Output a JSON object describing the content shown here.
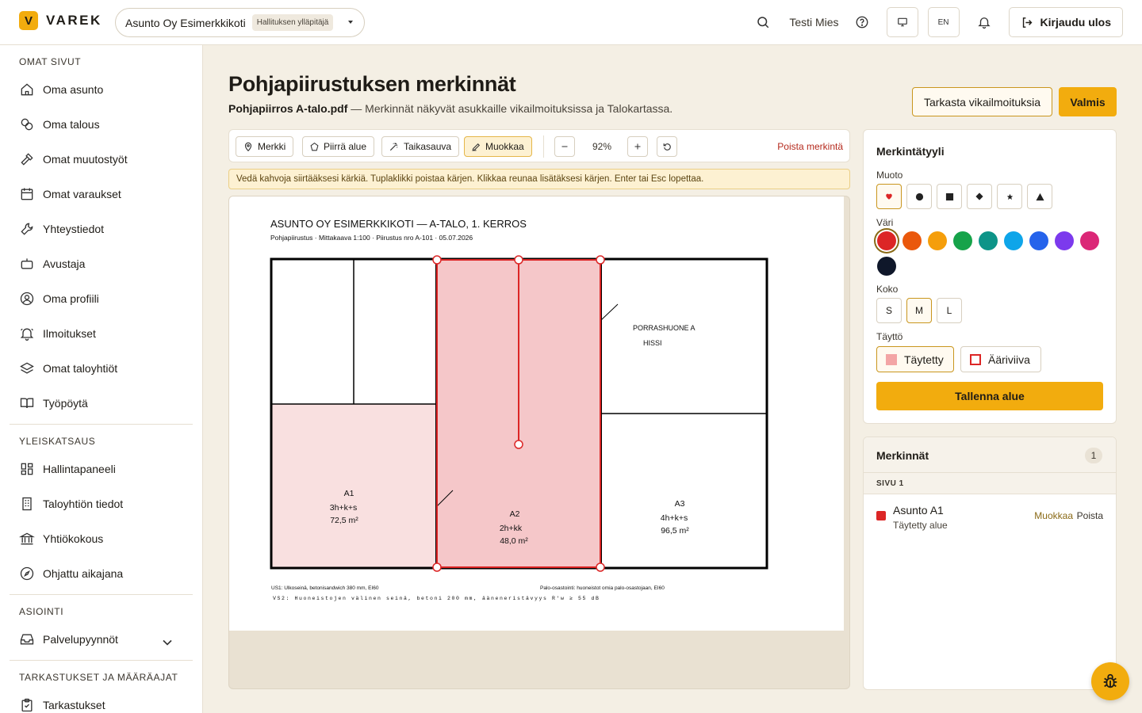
{
  "brand": {
    "logo_letter": "V",
    "name": "VAREK",
    "accent": "#f2ac0e"
  },
  "header": {
    "company": "Asunto Oy Esimerkkikoti",
    "role": "Hallituksen ylläpitäjä",
    "user": "Testi Mies",
    "lang": "EN",
    "logout": "Kirjaudu ulos"
  },
  "sidebar": {
    "sections": [
      {
        "title": "OMAT SIVUT",
        "items": [
          "Oma asunto",
          "Oma talous",
          "Omat muutostyöt",
          "Omat varaukset",
          "Yhteystiedot",
          "Avustaja",
          "Oma profiili",
          "Ilmoitukset",
          "Omat taloyhtiöt",
          "Työpöytä"
        ]
      },
      {
        "title": "YLEISKATSAUS",
        "items": [
          "Hallintapaneeli",
          "Taloyhtiön tiedot",
          "Yhtiökokous",
          "Ohjattu aikajana"
        ]
      },
      {
        "title": "ASIOINTI",
        "items": [
          "Palvelupyynnöt"
        ]
      },
      {
        "title": "TARKASTUKSET JA MÄÄRÄAJAT",
        "items": [
          "Tarkastukset"
        ]
      }
    ]
  },
  "page": {
    "title": "Pohjapiirustuksen merkinnät",
    "file": "Pohjapiirros A-talo.pdf",
    "description": " — Merkinnät näkyvät asukkaille vikailmoituksissa ja Talokartassa.",
    "check_button": "Tarkasta vikailmoituksia",
    "done_button": "Valmis"
  },
  "toolbar": {
    "marker": "Merkki",
    "draw_area": "Piirrä alue",
    "magic_wand": "Taikasauva",
    "edit": "Muokkaa",
    "zoom": "92%",
    "delete": "Poista merkintä"
  },
  "hint": "Vedä kahvoja siirtääksesi kärkiä. Tuplaklikki poistaa kärjen. Klikkaa reunaa lisätäksesi kärjen. Enter tai Esc lopettaa.",
  "plan": {
    "title": "ASUNTO OY ESIMERKKIKOTI — A-TALO, 1. KERROS",
    "subtitle": "Pohjapiirustus · Mittakaava 1:100 · Piirustus nro A-101 · 05.07.2026",
    "stair_label": "PORRASHUONE A",
    "elevator_label": "HISSI",
    "apartments": [
      {
        "id": "A1",
        "type": "3h+k+s",
        "area": "72,5 m²"
      },
      {
        "id": "A2",
        "type": "2h+kk",
        "area": "48,0 m²"
      },
      {
        "id": "A3",
        "type": "4h+k+s",
        "area": "96,5 m²"
      }
    ],
    "note_us1": "US1: Ulkoseinä, betonisandwich 380 mm, EI60",
    "note_fire": "Palo-osastointi: huoneistot omia palo-osastojaan, EI60",
    "note_vs2": "VS2: Huoneistojen välinen seinä, betoni 200 mm, ääneneristävyys R'w ≥ 55 dB"
  },
  "style_panel": {
    "title": "Merkintätyyli",
    "shape_label": "Muoto",
    "shapes": [
      "heart",
      "circle",
      "square",
      "diamond",
      "star",
      "triangle"
    ],
    "color_label": "Väri",
    "colors": [
      "#dc2626",
      "#ea580c",
      "#f59e0b",
      "#16a34a",
      "#0d9488",
      "#0ea5e9",
      "#2563eb",
      "#7c3aed",
      "#db2777",
      "#0f172a"
    ],
    "size_label": "Koko",
    "sizes": [
      "S",
      "M",
      "L"
    ],
    "fill_label": "Täyttö",
    "fill_filled": "Täytetty",
    "fill_outline": "Ääriviiva",
    "save": "Tallenna alue"
  },
  "marks_panel": {
    "title": "Merkinnät",
    "count": "1",
    "page_label": "SIVU 1",
    "items": [
      {
        "title": "Asunto A1",
        "desc": "Täytetty alue",
        "edit": "Muokkaa",
        "delete": "Poista"
      }
    ]
  }
}
